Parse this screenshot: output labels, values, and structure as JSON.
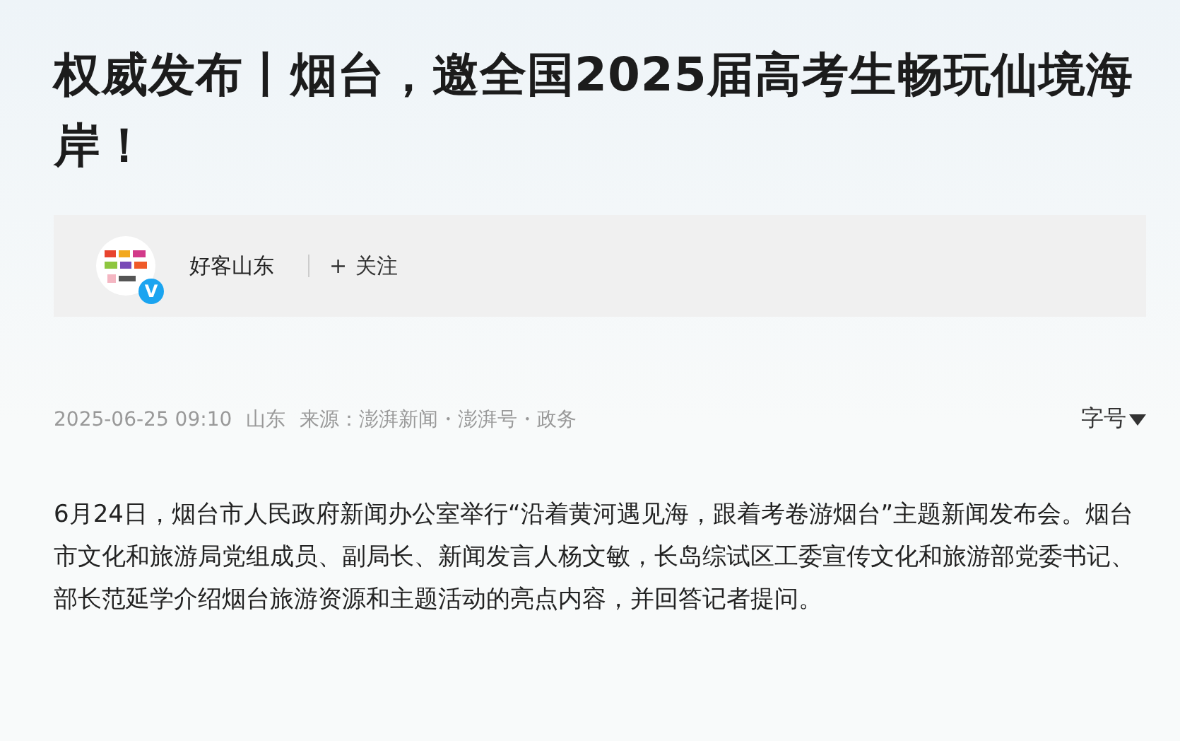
{
  "title": "权威发布丨烟台，邀全国2025届高考生畅玩仙境海岸！",
  "author": {
    "name": "好客山东",
    "verified_badge": "V",
    "follow": {
      "icon": "+",
      "label": "关注"
    }
  },
  "meta": {
    "time": "2025-06-25 09:10",
    "location": "山东",
    "source": "来源：澎湃新闻・澎湃号・政务",
    "font_size": "字号"
  },
  "body": [
    "6月24日，烟台市人民政府新闻办公室举行“沿着黄河遇见海，跟着考卷游烟台”主题新闻发布会。烟台市文化和旅游局党组成员、副局长、新闻发言人杨文敏，长岛综试区工委宣传文化和旅游部党委书记、部长范延学介绍烟台旅游资源和主题活动的亮点内容，并回答记者提问。"
  ]
}
